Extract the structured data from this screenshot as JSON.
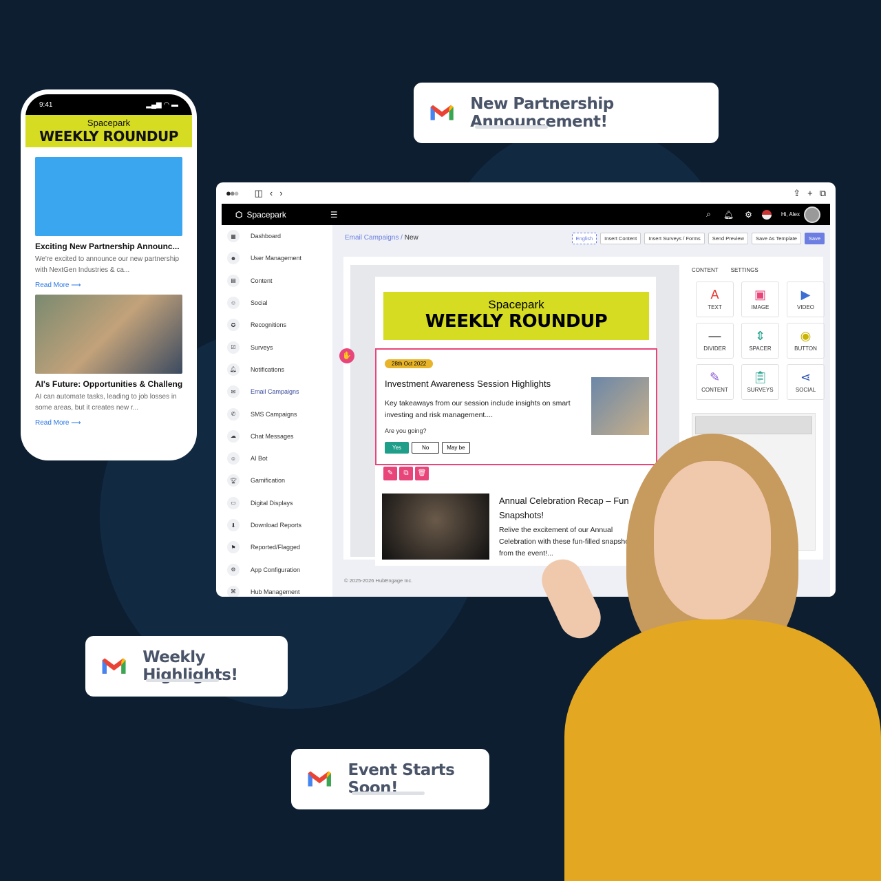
{
  "notifications": [
    {
      "title": "New Partnership Announcement!"
    },
    {
      "title": "Weekly Highlights!"
    },
    {
      "title": "Event Starts Soon!"
    }
  ],
  "phone": {
    "time": "9:41",
    "brand": "Spacepark",
    "banner": "WEEKLY ROUNDUP",
    "articles": [
      {
        "title": "Exciting New Partnership Announc...",
        "desc": "We're excited to announce our new partnership with NextGen Industries & ca...",
        "link": "Read More ⟶"
      },
      {
        "title": "AI's Future: Opportunities & Challeng",
        "desc": "AI can automate tasks, leading to job losses in some areas, but it creates new r...",
        "link": "Read More ⟶"
      }
    ]
  },
  "app": {
    "brand": "Spacepark",
    "user": "Hi, Alex",
    "sidebar": [
      "Dashboard",
      "User Management",
      "Content",
      "Social",
      "Recognitions",
      "Surveys",
      "Notifications",
      "Email Campaigns",
      "SMS Campaigns",
      "Chat Messages",
      "AI Bot",
      "Gamification",
      "Digital Displays",
      "Download Reports",
      "Reported/Flagged",
      "App Configuration",
      "Hub Management"
    ],
    "active_item": "Email Campaigns",
    "breadcrumb": {
      "parent": "Email Campaigns",
      "sep": "/",
      "current": "New"
    },
    "toolbar": {
      "language": "English",
      "insert_content": "Insert Content",
      "insert_surveys": "Insert Surveys / Forms",
      "send_preview": "Send Preview",
      "save_template": "Save As Template",
      "save": "Save"
    },
    "tabs": [
      "CONTENT",
      "SETTINGS"
    ],
    "tiles": [
      "TEXT",
      "IMAGE",
      "VIDEO",
      "DIVIDER",
      "SPACER",
      "BUTTON",
      "CONTENT",
      "SURVEYS",
      "SOCIAL"
    ],
    "email": {
      "brand": "Spacepark",
      "banner": "WEEKLY ROUNDUP",
      "date": "28th Oct 2022",
      "headline": "Investment Awareness Session Highlights",
      "body": "Key takeaways from our session include insights on smart investing and risk management....",
      "question": "Are you going?",
      "options": [
        "Yes",
        "No",
        "May be"
      ],
      "second_title": "Annual Celebration Recap – Fun Snapshots!",
      "second_body": "Relive the excitement of our Annual Celebration with these fun-filled snapshots from the event!..."
    },
    "footer": "© 2025-2026 HubEngage Inc."
  },
  "colors": {
    "background": "#0d1e31",
    "accent": "#6c7ee1",
    "banner": "#d6dc22",
    "selection": "#e8457a",
    "teal": "#1f9e8a"
  }
}
